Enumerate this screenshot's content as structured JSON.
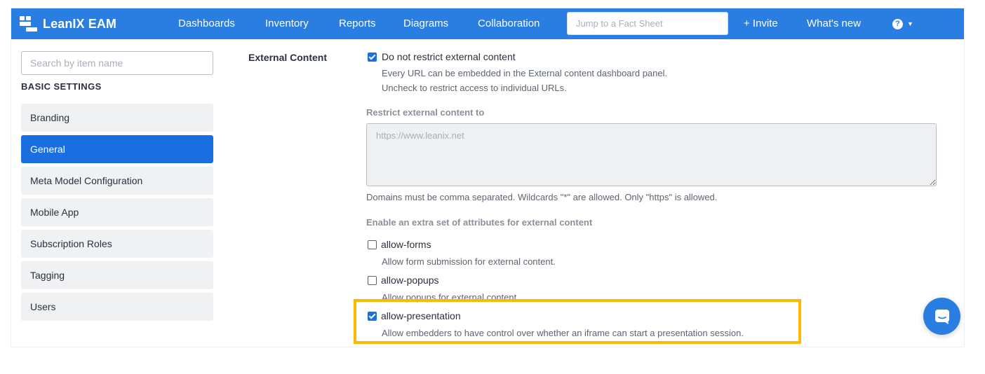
{
  "app": {
    "logo_text": "LeanIX EAM"
  },
  "nav": {
    "items": [
      "Dashboards",
      "Inventory",
      "Reports",
      "Diagrams",
      "Collaboration"
    ],
    "jump_placeholder": "Jump to a Fact Sheet",
    "invite": "+ Invite",
    "whats_new": "What's new",
    "help_glyph": "?"
  },
  "sidebar": {
    "search_placeholder": "Search by item name",
    "heading": "BASIC SETTINGS",
    "items": [
      {
        "label": "Branding",
        "active": false
      },
      {
        "label": "General",
        "active": true
      },
      {
        "label": "Meta Model Configuration",
        "active": false
      },
      {
        "label": "Mobile App",
        "active": false
      },
      {
        "label": "Subscription Roles",
        "active": false
      },
      {
        "label": "Tagging",
        "active": false
      },
      {
        "label": "Users",
        "active": false
      }
    ]
  },
  "content": {
    "section_title": "External Content",
    "unrestricted": {
      "checked": true,
      "label": "Do not restrict external content",
      "help_line1": "Every URL can be embedded in the External content dashboard panel.",
      "help_line2": "Uncheck to restrict access to individual URLs."
    },
    "restrict_label": "Restrict external content to",
    "restrict_placeholder": "https://www.leanix.net",
    "restrict_help": "Domains must be comma separated. Wildcards \"*\" are allowed. Only \"https\" is allowed.",
    "attributes_label": "Enable an extra set of attributes for external content",
    "attributes": [
      {
        "name": "allow-forms",
        "checked": false,
        "description": "Allow form submission for external content."
      },
      {
        "name": "allow-popups",
        "checked": false,
        "description": "Allow popups for external content."
      },
      {
        "name": "allow-presentation",
        "checked": true,
        "description": "Allow embedders to have control over whether an iframe can start a presentation session."
      }
    ]
  },
  "colors": {
    "brand": "#2a7de1",
    "active": "#1a6fe0",
    "highlight": "#fbb900"
  },
  "icons": {
    "logo": "leanix-logo-icon",
    "help": "help-circle-icon",
    "chat": "chat-bubble-icon"
  }
}
